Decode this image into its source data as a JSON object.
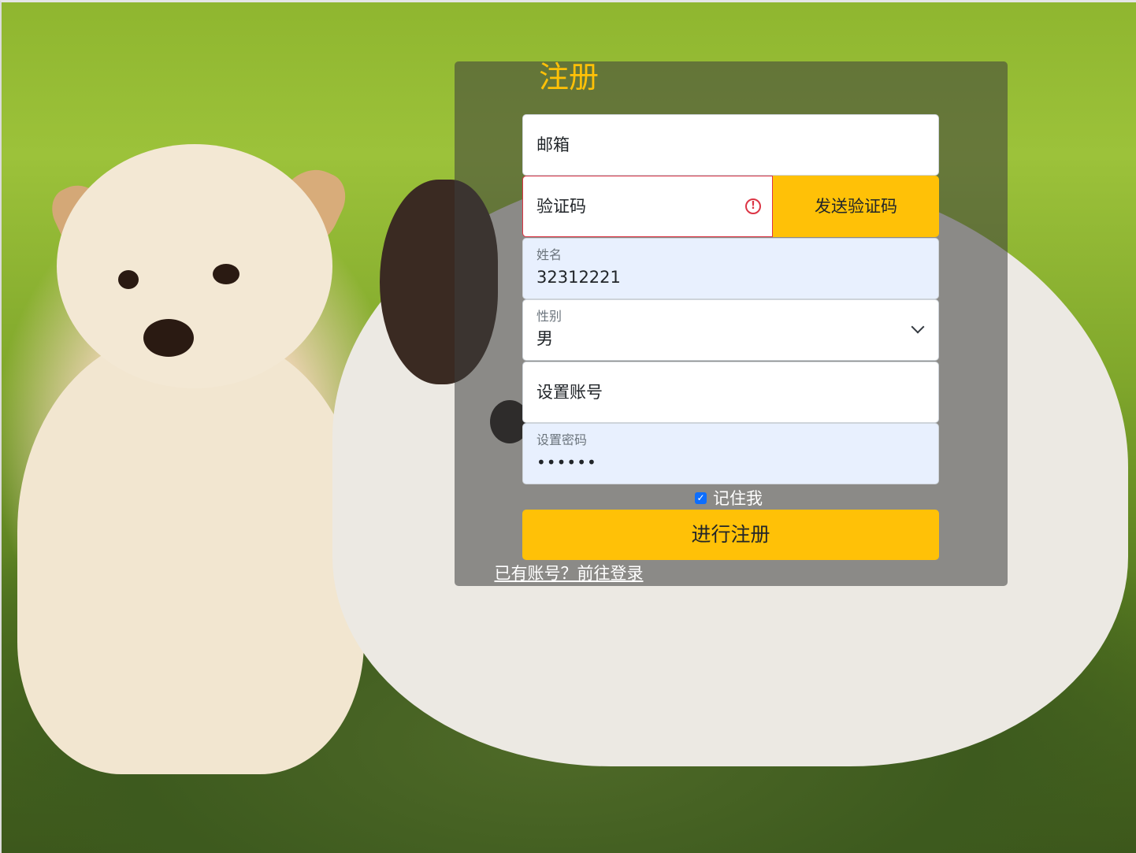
{
  "form": {
    "title": "注册",
    "email": {
      "placeholder": "邮箱"
    },
    "code": {
      "placeholder": "验证码",
      "state": "invalid"
    },
    "send_code_label": "发送验证码",
    "name": {
      "label": "姓名",
      "value": "32312221"
    },
    "gender": {
      "label": "性别",
      "value": "男"
    },
    "account": {
      "placeholder": "设置账号"
    },
    "password": {
      "label": "设置密码",
      "value": "••••••"
    },
    "remember": {
      "label": "记住我",
      "checked": true
    },
    "submit_label": "进行注册",
    "login_link": "已有账号？前往登录"
  },
  "colors": {
    "accent": "#ffc107",
    "error": "#dc3545",
    "checkbox": "#0d6efd",
    "autofill_bg": "#e8f0fe"
  },
  "icons": {
    "code_status": "exclamation-circle-icon",
    "gender_select": "chevron-down-icon",
    "remember_checkbox": "checkmark-icon"
  }
}
